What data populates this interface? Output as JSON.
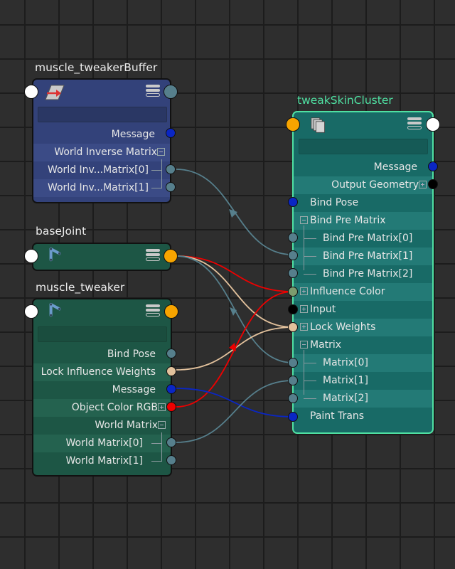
{
  "colors": {
    "message_plug": "#0a26c4",
    "matrix_plug": "#567f8c",
    "weights_plug": "#e2c19c",
    "color_plug": "#ee0000",
    "influence_color_plug": "#7c9c6e",
    "black_plug": "#000000",
    "node_in_out": "#ffffff",
    "node_joint_out": "#f7a400",
    "node_selected_outline": "#4fe0a2"
  },
  "nodes": {
    "buffer": {
      "title": "muscle_tweakerBuffer",
      "icon": "transform-arrow-icon",
      "filter_value": "",
      "rows": [
        {
          "label": "Message",
          "plug": "message",
          "expand": null
        },
        {
          "label": "World Inverse Matrix",
          "plug": null,
          "expand": "collapse"
        },
        {
          "label": "World Inv...Matrix[0]",
          "plug": "matrix",
          "expand": null
        },
        {
          "label": "World Inv...Matrix[1]",
          "plug": "matrix",
          "expand": null
        }
      ]
    },
    "basejoint": {
      "title": "baseJoint",
      "icon": "joint-icon"
    },
    "tweaker": {
      "title": "muscle_tweaker",
      "icon": "joint-icon",
      "filter_value": "",
      "rows": [
        {
          "label": "Bind Pose",
          "plug": "matrix",
          "expand": null
        },
        {
          "label": "Lock Influence Weights",
          "plug": "weights",
          "expand": null
        },
        {
          "label": "Message",
          "plug": "message",
          "expand": null
        },
        {
          "label": "Object Color RGB",
          "plug": "color",
          "expand": "expand"
        },
        {
          "label": "World Matrix",
          "plug": null,
          "expand": "collapse"
        },
        {
          "label": "World Matrix[0]",
          "plug": "matrix",
          "expand": null
        },
        {
          "label": "World Matrix[1]",
          "plug": "matrix",
          "expand": null
        }
      ]
    },
    "skincluster": {
      "title": "tweakSkinCluster",
      "icon": "deformer-stack-icon",
      "filter_value": "",
      "rows": [
        {
          "label": "Message",
          "side": "out",
          "expand": null
        },
        {
          "label": "Output Geometry",
          "side": "out",
          "expand": "expand"
        },
        {
          "label": "Bind Pose",
          "side": "in",
          "expand": null
        },
        {
          "label": "Bind Pre Matrix",
          "side": "in",
          "expand": "collapse"
        },
        {
          "label": "Bind Pre Matrix[0]",
          "side": "in",
          "expand": null
        },
        {
          "label": "Bind Pre Matrix[1]",
          "side": "in",
          "expand": null
        },
        {
          "label": "Bind Pre Matrix[2]",
          "side": "in",
          "expand": null
        },
        {
          "label": "Influence Color",
          "side": "in",
          "expand": "expand"
        },
        {
          "label": "Input",
          "side": "in",
          "expand": "expand"
        },
        {
          "label": "Lock Weights",
          "side": "in",
          "expand": "expand"
        },
        {
          "label": "Matrix",
          "side": "in",
          "expand": "collapse"
        },
        {
          "label": "Matrix[0]",
          "side": "in",
          "expand": null
        },
        {
          "label": "Matrix[1]",
          "side": "in",
          "expand": null
        },
        {
          "label": "Matrix[2]",
          "side": "in",
          "expand": null
        },
        {
          "label": "Paint Trans",
          "side": "in",
          "expand": null
        }
      ]
    }
  },
  "connections": [
    {
      "from": "muscle_tweakerBuffer.World Inv...Matrix[0]",
      "to": "tweakSkinCluster.Bind Pre Matrix[1]",
      "color": "#567f8c"
    },
    {
      "from": "baseJoint",
      "to": "tweakSkinCluster.Influence Color",
      "color": "#ee0000"
    },
    {
      "from": "baseJoint",
      "to": "tweakSkinCluster.Lock Weights",
      "color": "#e2c19c"
    },
    {
      "from": "baseJoint",
      "to": "tweakSkinCluster.Matrix[0]",
      "color": "#567f8c"
    },
    {
      "from": "muscle_tweaker.Lock Influence Weights",
      "to": "tweakSkinCluster.Lock Weights",
      "color": "#e2c19c"
    },
    {
      "from": "muscle_tweaker.Object Color RGB",
      "to": "tweakSkinCluster.Influence Color",
      "color": "#ee0000"
    },
    {
      "from": "muscle_tweaker.Message",
      "to": "tweakSkinCluster.Paint Trans",
      "color": "#0a26c4"
    },
    {
      "from": "muscle_tweaker.World Matrix[0]",
      "to": "tweakSkinCluster.Matrix[1]",
      "color": "#567f8c"
    }
  ]
}
